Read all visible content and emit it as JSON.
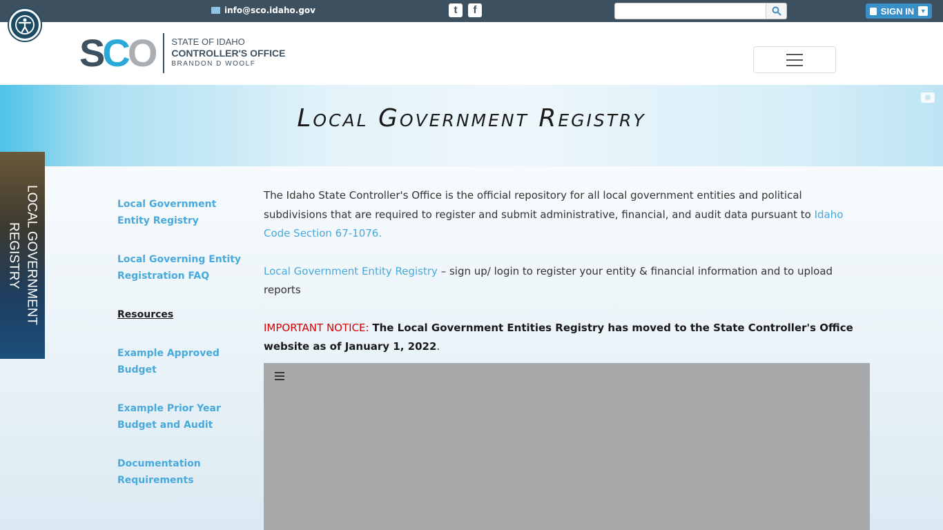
{
  "topbar": {
    "email": "info@sco.idaho.gov",
    "social": [
      {
        "name": "twitter-icon",
        "glyph": "t"
      },
      {
        "name": "facebook-icon",
        "glyph": "f"
      }
    ],
    "search_placeholder": "",
    "signin_label": "SIGN IN"
  },
  "header": {
    "logo_mark_s": "S",
    "logo_mark_c": "C",
    "logo_mark_o": "O",
    "logo_line1": "STATE OF IDAHO",
    "logo_line2": "CONTROLLER'S OFFICE",
    "logo_line3": "BRANDON D WOOLF"
  },
  "banner": {
    "title": "Local Government Registry"
  },
  "sidetab": {
    "label": "LOCAL GOVERNMENT REGISTRY"
  },
  "sidenav": {
    "items": [
      {
        "label": "Local Government Entity Registry",
        "active": false
      },
      {
        "label": "Local Governing Entity Registration FAQ",
        "active": false
      },
      {
        "label": "Resources",
        "active": true
      },
      {
        "label": "Example Approved Budget",
        "active": false
      },
      {
        "label": "Example Prior Year Budget and Audit",
        "active": false
      },
      {
        "label": "Documentation Requirements",
        "active": false
      }
    ]
  },
  "main": {
    "intro": "The Idaho State Controller's Office is the official repository for all local government entities and political subdivisions that are required to register and submit administrative, financial, and audit data pursuant to ",
    "intro_link": "Idaho Code Section 67-1076.",
    "registry_link": "Local Government Entity Registry",
    "registry_text": " – sign up/ login to register your entity & financial information and to upload reports",
    "notice_label": "IMPORTANT NOTICE: ",
    "notice_text": "The Local Government Entities Registry has moved to the State Controller's Office website as of January 1, 2022",
    "notice_end": "."
  },
  "colors": {
    "topbar": "#3d5060",
    "link": "#48a9dc",
    "notice": "#d40000",
    "signin": "#3a8fc8"
  }
}
